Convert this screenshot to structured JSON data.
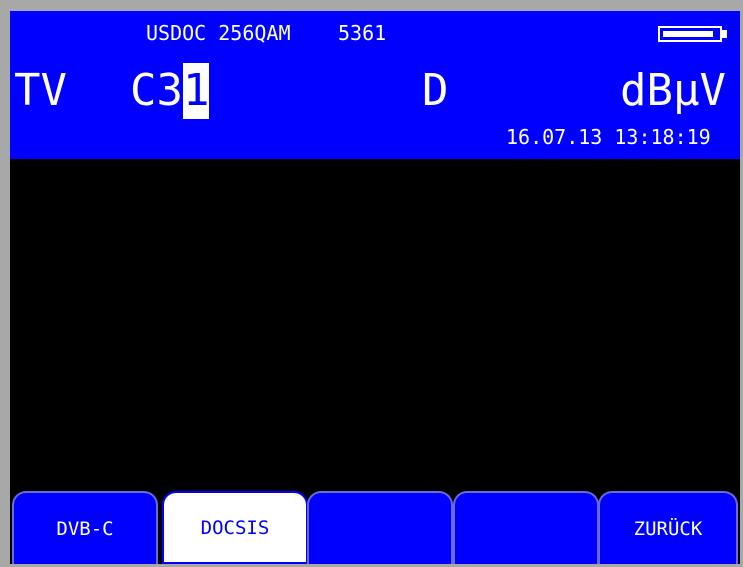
{
  "header": {
    "mode": "USDOC 256QAM",
    "code": "5361",
    "band": "TV",
    "channel_prefix": "C3",
    "channel_cursor": "1",
    "standard": "D",
    "unit": "dBµV",
    "datetime": "16.07.13 13:18:19",
    "battery_level": 0.92
  },
  "softkeys": [
    {
      "label": "DVB-C",
      "active": false
    },
    {
      "label": "DOCSIS",
      "active": true
    },
    {
      "label": "",
      "active": false
    },
    {
      "label": "",
      "active": false
    },
    {
      "label": "ZURÜCK",
      "active": false
    }
  ],
  "colors": {
    "header_bg": "#0000ff",
    "screen_bg": "#000000",
    "bezel": "#a8a8a8",
    "text": "#ffffff"
  }
}
